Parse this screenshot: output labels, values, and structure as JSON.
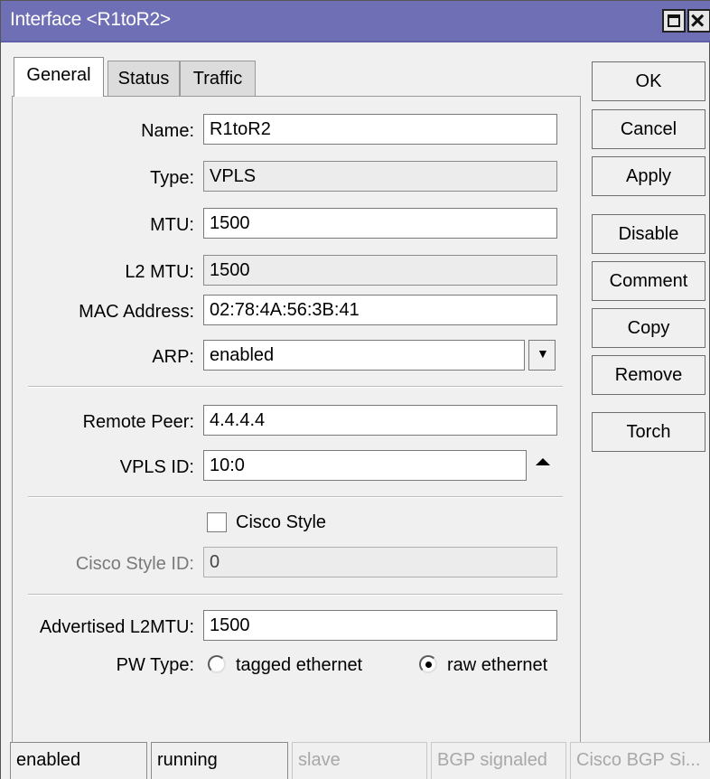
{
  "window": {
    "title": "Interface <R1toR2>"
  },
  "tabs": [
    {
      "label": "General",
      "active": true
    },
    {
      "label": "Status",
      "active": false
    },
    {
      "label": "Traffic",
      "active": false
    }
  ],
  "form": {
    "name": {
      "label": "Name:",
      "value": "R1toR2"
    },
    "type": {
      "label": "Type:",
      "value": "VPLS"
    },
    "mtu": {
      "label": "MTU:",
      "value": "1500"
    },
    "l2mtu": {
      "label": "L2 MTU:",
      "value": "1500"
    },
    "mac": {
      "label": "MAC Address:",
      "value": "02:78:4A:56:3B:41"
    },
    "arp": {
      "label": "ARP:",
      "value": "enabled"
    },
    "remote_peer": {
      "label": "Remote Peer:",
      "value": "4.4.4.4"
    },
    "vpls_id": {
      "label": "VPLS ID:",
      "value": "10:0"
    },
    "cisco_style": {
      "label": "Cisco Style",
      "checked": false
    },
    "cisco_style_id": {
      "label": "Cisco Style ID:",
      "value": "0"
    },
    "advertised_l2mtu": {
      "label": "Advertised L2MTU:",
      "value": "1500"
    },
    "pw_type": {
      "label": "PW Type:",
      "options": [
        "tagged ethernet",
        "raw ethernet"
      ],
      "selected": "raw ethernet"
    }
  },
  "buttons": {
    "ok": "OK",
    "cancel": "Cancel",
    "apply": "Apply",
    "disable": "Disable",
    "comment": "Comment",
    "copy": "Copy",
    "remove": "Remove",
    "torch": "Torch"
  },
  "statusbar": {
    "enabled": "enabled",
    "running": "running",
    "slave": "slave",
    "bgp_signaled": "BGP signaled",
    "cisco_bgp": "Cisco BGP Si..."
  },
  "colors": {
    "titlebar": "#6f6fb6",
    "face": "#f0f0f0"
  }
}
